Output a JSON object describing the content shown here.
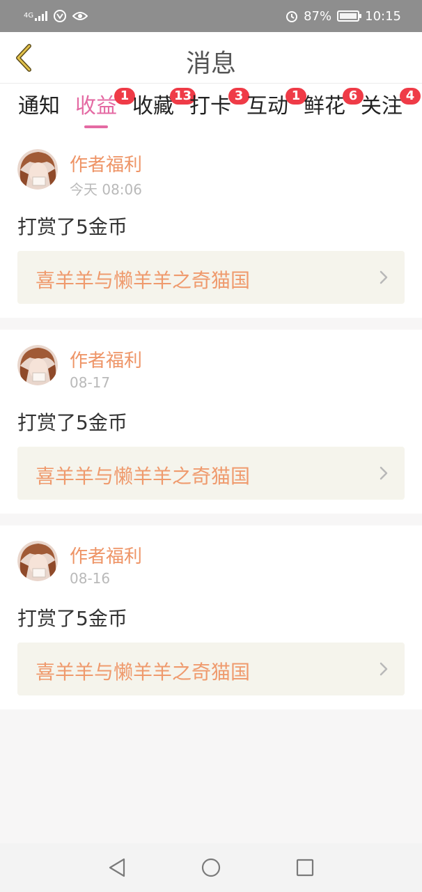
{
  "status_bar": {
    "network": "4G",
    "battery_percent": "87%",
    "time": "10:15",
    "icons": [
      "signal-icon",
      "data-icon",
      "eye-icon",
      "alarm-icon",
      "battery-icon"
    ]
  },
  "header": {
    "title": "消息",
    "back_icon": "back-chevron-icon"
  },
  "tabs": [
    {
      "label": "通知",
      "badge": "",
      "active": false
    },
    {
      "label": "收益",
      "badge": "1",
      "active": true
    },
    {
      "label": "收藏",
      "badge": "13",
      "active": false
    },
    {
      "label": "打卡",
      "badge": "3",
      "active": false
    },
    {
      "label": "互动",
      "badge": "1",
      "active": false
    },
    {
      "label": "鲜花",
      "badge": "6",
      "active": false
    },
    {
      "label": "关注",
      "badge": "4",
      "active": false
    }
  ],
  "messages": [
    {
      "author": "作者福利",
      "time": "今天 08:06",
      "text": "打赏了5金币",
      "book_title": "喜羊羊与懒羊羊之奇猫国"
    },
    {
      "author": "作者福利",
      "time": "08-17",
      "text": "打赏了5金币",
      "book_title": "喜羊羊与懒羊羊之奇猫国"
    },
    {
      "author": "作者福利",
      "time": "08-16",
      "text": "打赏了5金币",
      "book_title": "喜羊羊与懒羊羊之奇猫国"
    }
  ],
  "colors": {
    "accent": "#e46aa3",
    "author": "#ee9466",
    "badge": "#ef3b47",
    "back": "#d8b437"
  }
}
